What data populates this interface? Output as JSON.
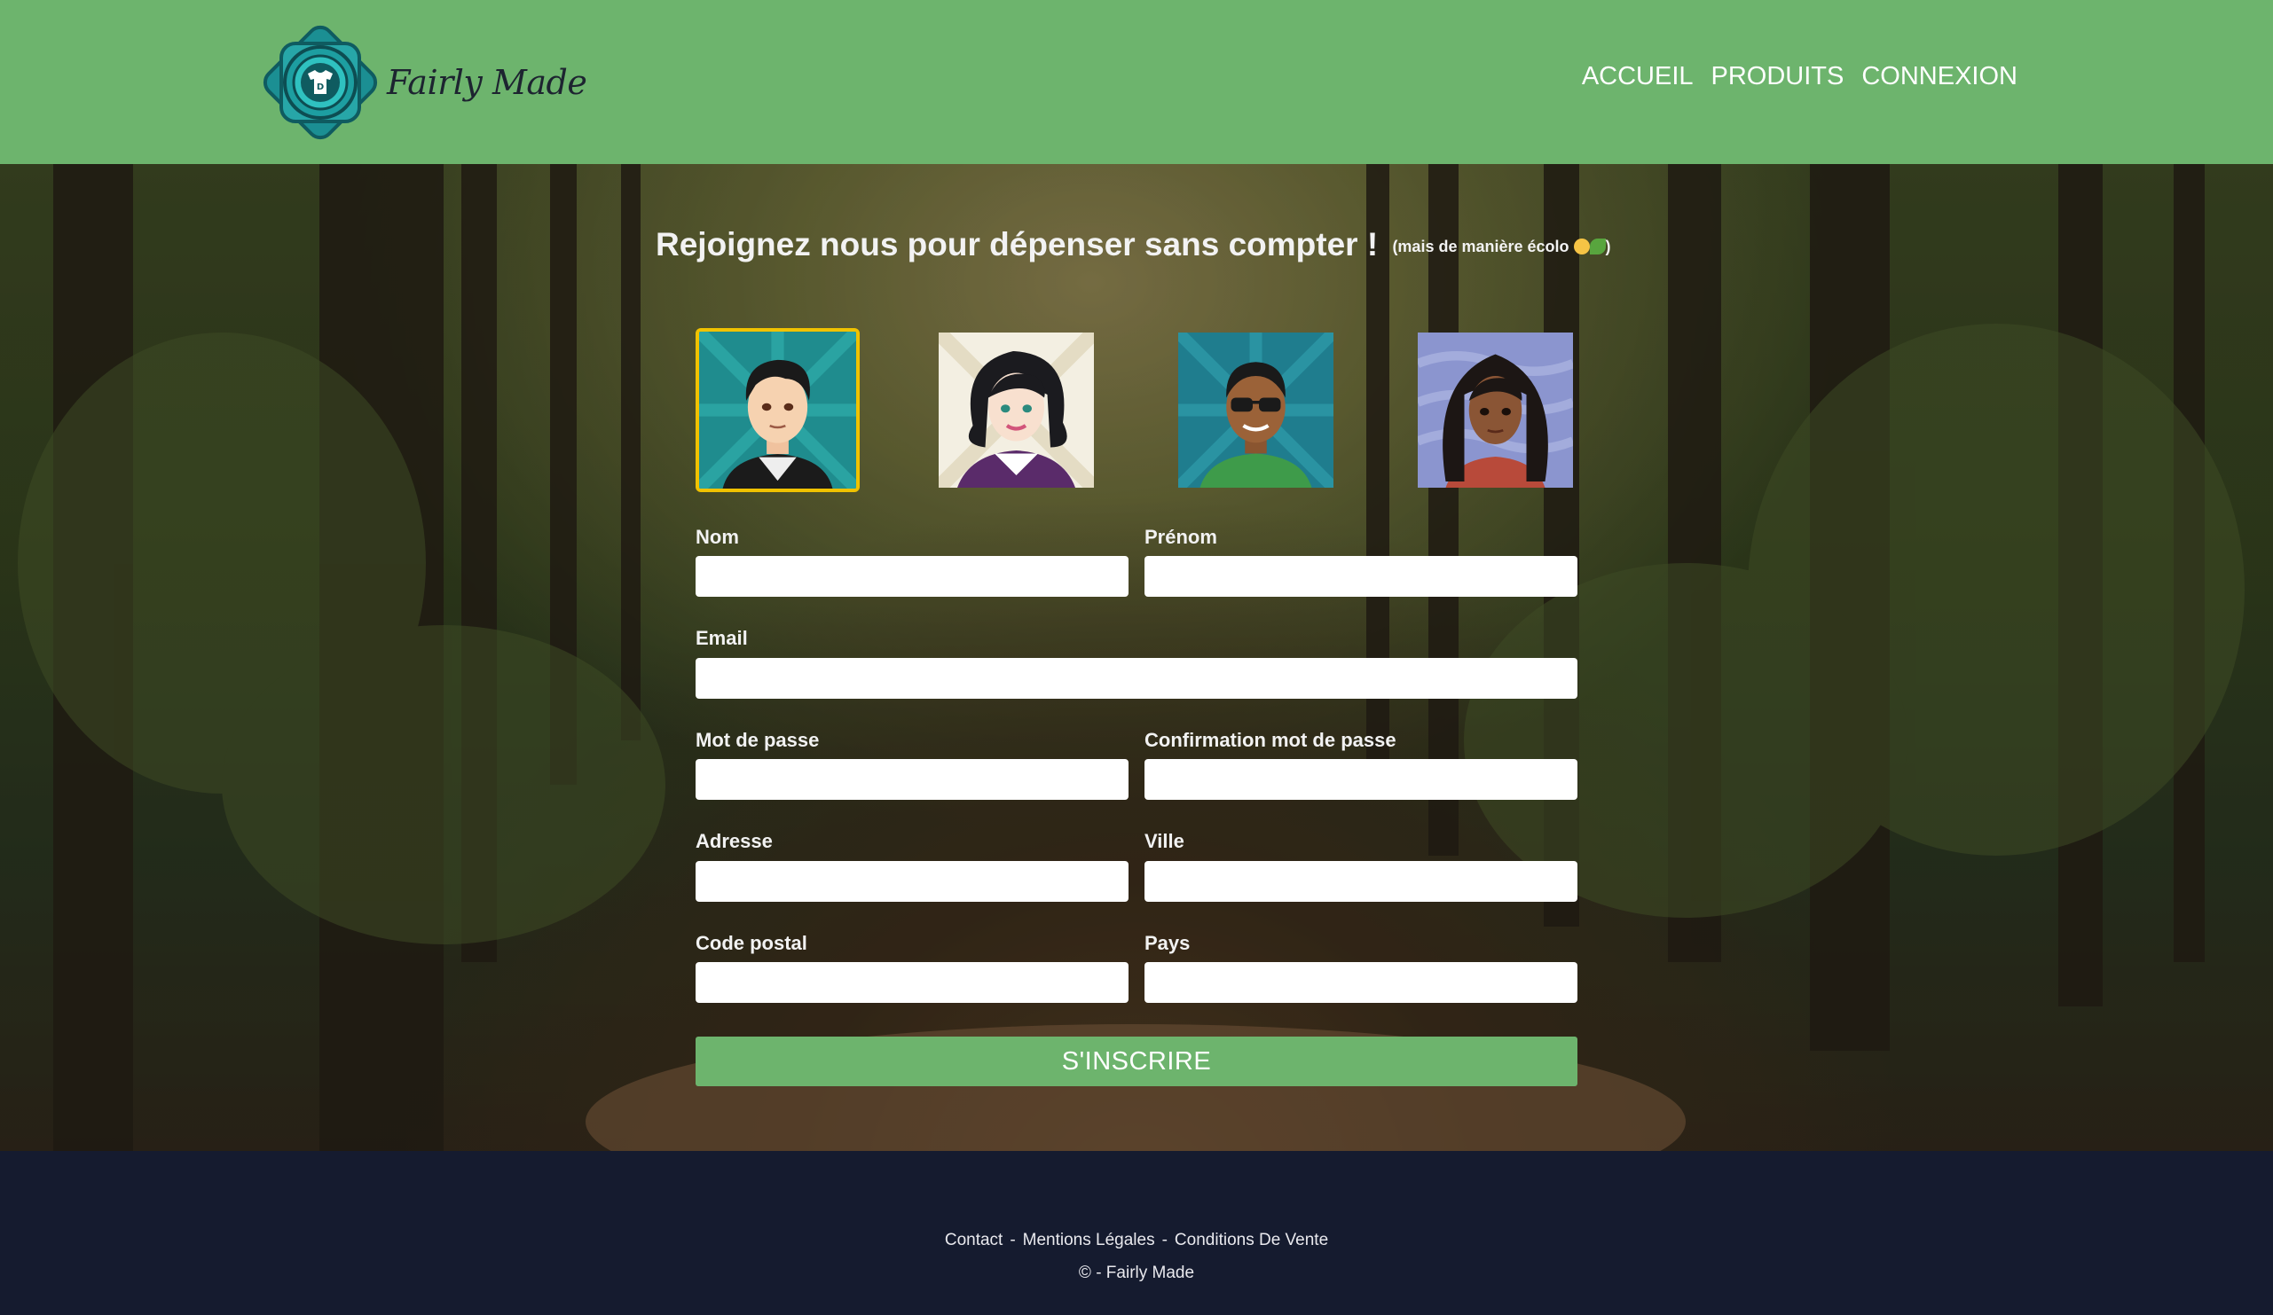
{
  "header": {
    "logo_text": "Fairly Made",
    "nav": [
      "ACCUEIL",
      "PRODUITS",
      "CONNEXION"
    ]
  },
  "signup": {
    "title": "Rejoignez nous pour dépenser sans compter !",
    "subtitle_prefix": "(mais de manière écolo",
    "subtitle_suffix": ")",
    "avatars": [
      {
        "name": "avatar-man-black-hair",
        "selected": true
      },
      {
        "name": "avatar-woman-black-hair",
        "selected": false
      },
      {
        "name": "avatar-man-sunglasses",
        "selected": false
      },
      {
        "name": "avatar-woman-long-hair",
        "selected": false
      }
    ],
    "fields": {
      "nom": "Nom",
      "prenom": "Prénom",
      "email": "Email",
      "password": "Mot de passe",
      "password_confirm": "Confirmation mot de passe",
      "adresse": "Adresse",
      "ville": "Ville",
      "code_postal": "Code postal",
      "pays": "Pays"
    },
    "submit_label": "S'INSCRIRE"
  },
  "footer": {
    "links": [
      "Contact",
      "Mentions Légales",
      "Conditions De Vente"
    ],
    "separator": "-",
    "copyright": "© - Fairly Made"
  },
  "colors": {
    "brand_green": "#6db46d",
    "footer_bg": "#151b2f",
    "selected_border": "#f0c200"
  }
}
